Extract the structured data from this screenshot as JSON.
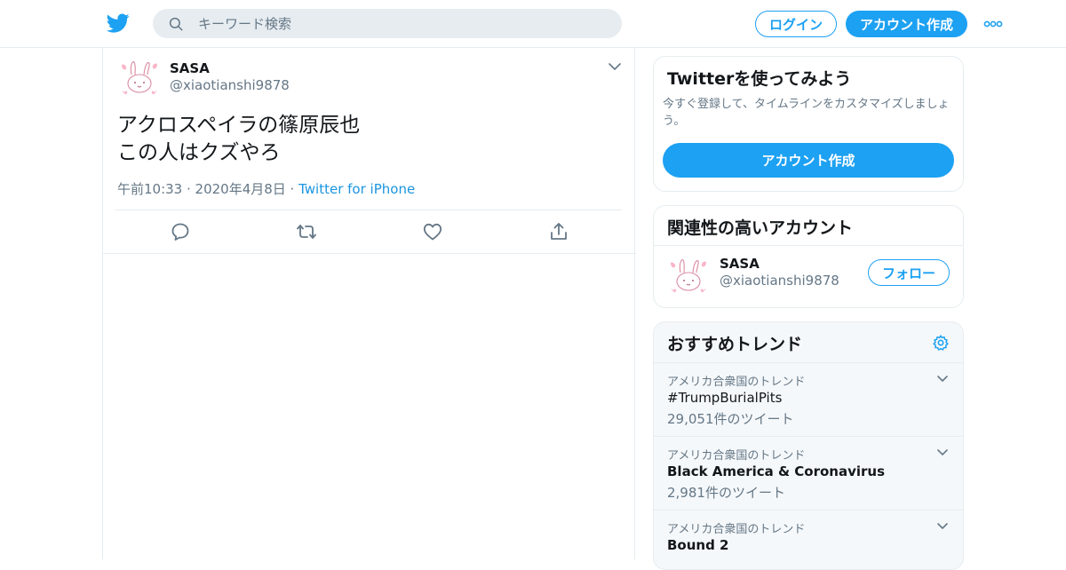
{
  "header": {
    "search_placeholder": "キーワード検索",
    "login_label": "ログイン",
    "signup_label": "アカウント作成"
  },
  "tweet": {
    "user_name": "SASA",
    "user_handle": "@xiaotianshi9878",
    "text_line1": "アクロスペイラの篠原辰也",
    "text_line2": "この人はクズやろ",
    "time": "午前10:33 · 2020年4月8日 · ",
    "source": "Twitter for iPhone"
  },
  "signup_card": {
    "title": "Twitterを使ってみよう",
    "description": "今すぐ登録して、タイムラインをカスタマイズしましょう。",
    "button": "アカウント作成"
  },
  "related_card": {
    "title": "関連性の高いアカウント",
    "user_name": "SASA",
    "user_handle": "@xiaotianshi9878",
    "follow_label": "フォロー"
  },
  "trends_card": {
    "title": "おすすめトレンド",
    "items": [
      {
        "context": "アメリカ合衆国のトレンド",
        "name": "#TrumpBurialPits",
        "count": "29,051件のツイート"
      },
      {
        "context": "アメリカ合衆国のトレンド",
        "name": "Black America & Coronavirus",
        "count": "2,981件のツイート"
      },
      {
        "context": "アメリカ合衆国のトレンド",
        "name": "Bound 2",
        "count": ""
      }
    ]
  },
  "colors": {
    "accent": "#1da1f2",
    "text_secondary": "#657786",
    "border": "#e6ecf0"
  }
}
